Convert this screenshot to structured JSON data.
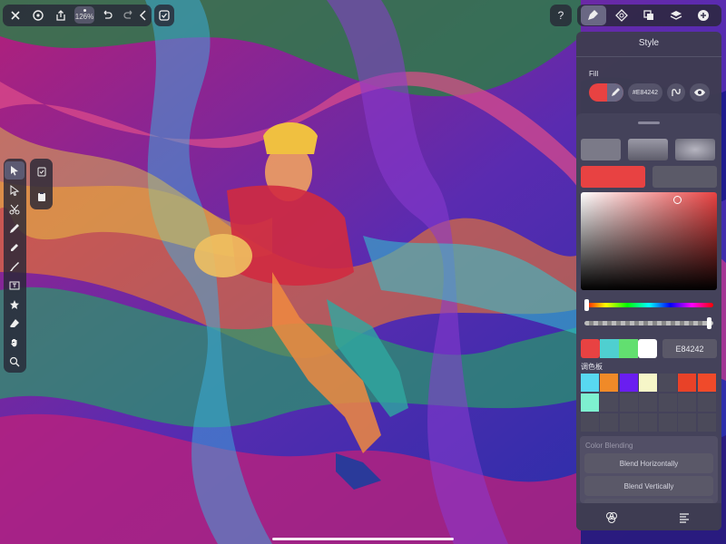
{
  "toolbar": {
    "zoom_label": "126%",
    "help_label": "?"
  },
  "panel": {
    "title": "Style",
    "fill_label": "Fill",
    "fill_hex": "#E84242",
    "hex_value": "E84242",
    "palette_title": "调色板",
    "blending_title": "Color Blending",
    "blend_h": "Blend Horizontally",
    "blend_v": "Blend Vertically"
  },
  "colors": {
    "fill": "#e84242",
    "recent": [
      "#e84242",
      "#4fcfd0",
      "#62df70",
      "#ffffff"
    ],
    "palette": [
      "#58d8f0",
      "#f08a28",
      "#6a1ef0",
      "#f6f6c8",
      "#4b4a5a",
      "#e84228",
      "#f04a2a",
      "#7ef0d0"
    ]
  },
  "icons": [
    "close-icon",
    "gear-icon",
    "share-icon",
    "undo-icon",
    "redo-icon",
    "chevron-left-icon",
    "checklist-icon",
    "help-icon",
    "brush-style-icon",
    "geometry-icon",
    "arrange-icon",
    "layers-icon",
    "add-icon",
    "eyedropper-icon",
    "path-icon",
    "eye-icon",
    "color-picker-tab-icon",
    "menu-icon"
  ]
}
